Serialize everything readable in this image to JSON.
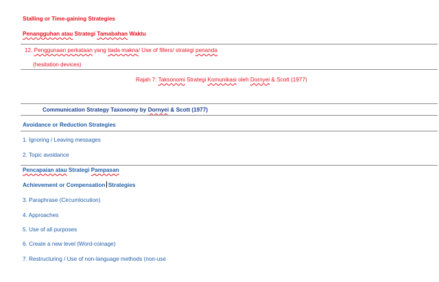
{
  "heading_en": "Stalling or Time-gaining Strategies",
  "heading_my": {
    "a": "Penangguhan atau",
    "b": " Strategi ",
    "c": "Tamabahan",
    "d": " Waktu"
  },
  "item12": {
    "prefix": "12. ",
    "a": "Penggunaan perkataan",
    "b": " yang ",
    "c": "tiada makna",
    "d": "/ Use of fillers/ strategi ",
    "e": "penanda"
  },
  "item12_cont": "(hesitation devices)",
  "caption": {
    "a": "Rajah 7:  ",
    "b": "Taksonomi",
    "c": " Strategi ",
    "d": "Komunikasi",
    "e": " oleh ",
    "f": "Dornyei",
    "g": " & Scott (1977)"
  },
  "table_title": {
    "a": "Communication Strategy Taxonomy by ",
    "b": "Dornyei",
    "c": " & Scott (1977)"
  },
  "avoidance_heading": "Avoidance or Reduction Strategies",
  "avoidance_items": [
    "1. Ignoring / Leaving messages",
    "2. Topic avoidance"
  ],
  "achievement_my": {
    "a": "Pencapaian atau",
    "b": " Strategi ",
    "c": "Pampasan"
  },
  "achievement_en": {
    "a": "Achievement or Compensation",
    "b": " Strategies"
  },
  "achievement_items": [
    "3. Paraphrase (Circumlocution)",
    "4. Approaches",
    "5. Use of all purposes",
    "6. Create a new level (Word-coinage)",
    "7. Restructuring / Use of non-language methods (non-use"
  ],
  "colors": {
    "red": "#e8101e",
    "blue": "#1d5ca8",
    "navy": "#1a3f8c",
    "rule": "#8a8a8a"
  }
}
